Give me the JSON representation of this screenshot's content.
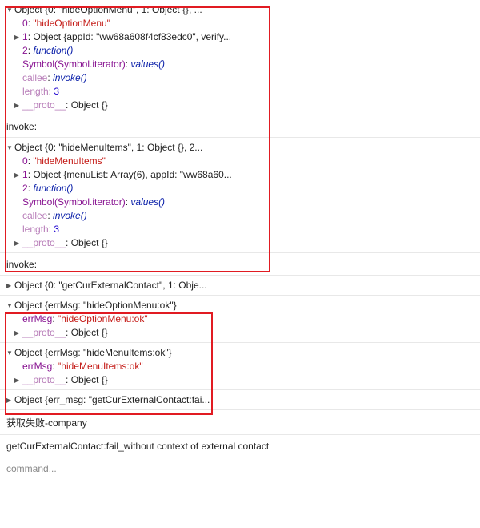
{
  "log": {
    "group1": {
      "summary": "Object {0: \"hideOptionMenu\", 1: Object {}, ...",
      "p0_key": "0",
      "p0_val": "\"hideOptionMenu\"",
      "p1_key": "1",
      "p1_val": "Object {appId: \"ww68a608f4cf83edc0\", verify...",
      "p2_key": "2",
      "p2_val": "function()",
      "p3_key": "Symbol(Symbol.iterator)",
      "p3_val": "values()",
      "p4_key": "callee",
      "p4_val": "invoke()",
      "p5_key": "length",
      "p5_val": "3",
      "p6_key": "__proto__",
      "p6_val": "Object {}"
    },
    "invoke1": "invoke:",
    "group2": {
      "summary": "Object {0: \"hideMenuItems\", 1: Object {}, 2...",
      "p0_key": "0",
      "p0_val": "\"hideMenuItems\"",
      "p1_key": "1",
      "p1_val": "Object {menuList: Array(6), appId: \"ww68a60...",
      "p2_key": "2",
      "p2_val": "function()",
      "p3_key": "Symbol(Symbol.iterator)",
      "p3_val": "values()",
      "p4_key": "callee",
      "p4_val": "invoke()",
      "p5_key": "length",
      "p5_val": "3",
      "p6_key": "__proto__",
      "p6_val": "Object {}"
    },
    "invoke2": "invoke:",
    "collapsed1": "Object {0: \"getCurExternalContact\", 1: Obje...",
    "group3": {
      "summary": "Object {errMsg: \"hideOptionMenu:ok\"}",
      "p0_key": "errMsg",
      "p0_val": "\"hideOptionMenu:ok\"",
      "p1_key": "__proto__",
      "p1_val": "Object {}"
    },
    "group4": {
      "summary": "Object {errMsg: \"hideMenuItems:ok\"}",
      "p0_key": "errMsg",
      "p0_val": "\"hideMenuItems:ok\"",
      "p1_key": "__proto__",
      "p1_val": "Object {}"
    },
    "collapsed2": "Object {err_msg: \"getCurExternalContact:fai...",
    "fail_text": "获取失败-company",
    "error_text": "getCurExternalContact:fail_without context of external contact"
  },
  "command": {
    "placeholder": "command..."
  },
  "colors": {
    "highlight": "#e11b22"
  },
  "icons": {
    "expanded": "triangle-down-icon",
    "collapsed": "triangle-right-icon"
  }
}
